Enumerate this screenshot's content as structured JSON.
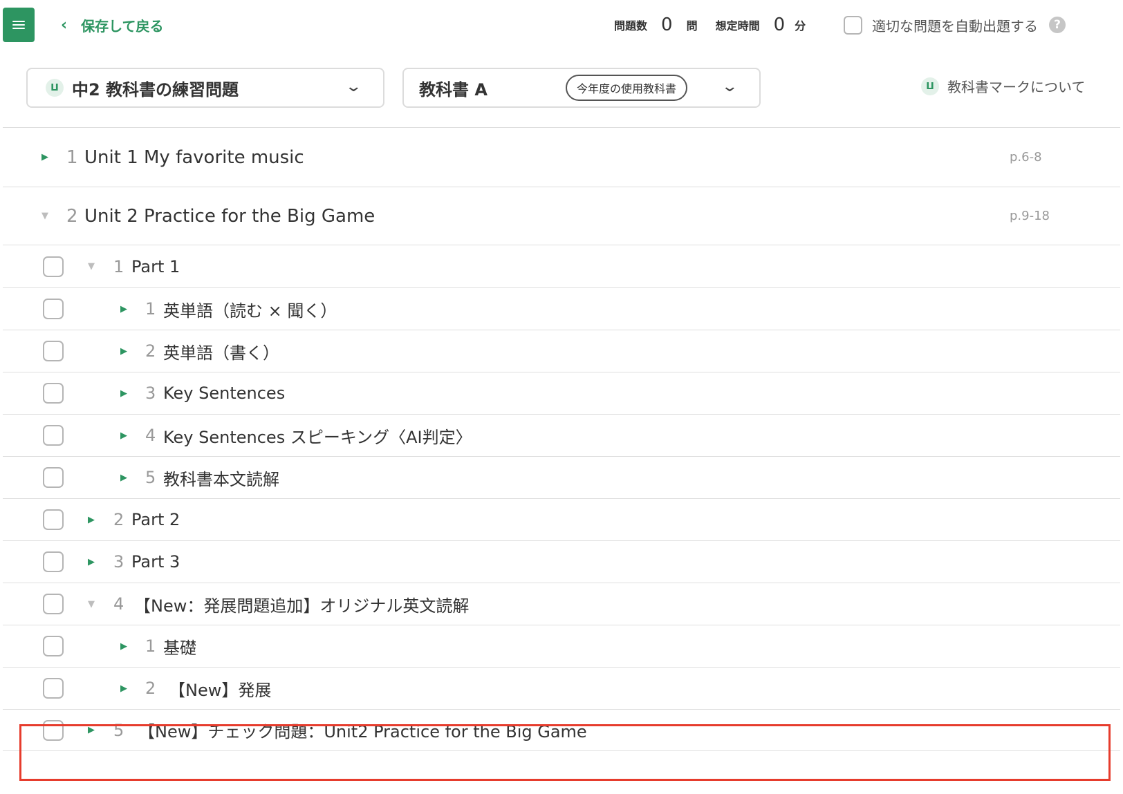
{
  "header": {
    "back_label": "保存して戻る",
    "back_icon": "chevron-left-icon",
    "menu_icon": "hamburger-menu-icon",
    "question_count_label": "問題数",
    "question_count": "0",
    "question_unit": "問",
    "time_label": "想定時間",
    "time_value": "0",
    "time_unit": "分",
    "auto_label": "適切な問題を自動出題する",
    "help_glyph": "?"
  },
  "selectors": {
    "course": "中2 教科書の練習問題",
    "textbook": "教科書 A",
    "textbook_badge": "今年度の使用教科書",
    "book_glyph": "ⵡ",
    "chevron_glyph": "⌄"
  },
  "mark_about": "教科書マークについて",
  "colors": {
    "accent": "#2d9561",
    "highlight": "#e63c2d",
    "border": "#dedede"
  },
  "list": [
    {
      "index": "1",
      "label": "Unit 1  My favorite music",
      "pages": "p.6-8",
      "expanded": false
    },
    {
      "index": "2",
      "label": "Unit 2  Practice for the Big Game",
      "pages": "p.9-18",
      "expanded": true
    },
    {
      "index": "1",
      "label": "Part 1",
      "expanded": true
    },
    {
      "index": "1",
      "label": "英単語（読む × 聞く）"
    },
    {
      "index": "2",
      "label": "英単語（書く）"
    },
    {
      "index": "3",
      "label": "Key Sentences"
    },
    {
      "index": "4",
      "label": "Key Sentences スピーキング〈AI判定〉"
    },
    {
      "index": "5",
      "label": "教科書本文読解"
    },
    {
      "index": "2",
      "label": "Part 2"
    },
    {
      "index": "3",
      "label": "Part 3"
    },
    {
      "index": "4",
      "label": "【New：発展問題追加】オリジナル英文読解",
      "expanded": true
    },
    {
      "index": "1",
      "label": "基礎"
    },
    {
      "index": "2",
      "label": "【New】発展"
    },
    {
      "index": "5",
      "label": "【New】チェック問題：Unit2 Practice for the Big Game"
    }
  ]
}
